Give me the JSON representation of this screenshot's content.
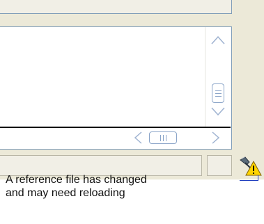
{
  "callout": {
    "line1": "A reference file has changed",
    "line2": "and may need reloading"
  },
  "icons": {
    "scroll_up": "chevron-up-icon",
    "scroll_down": "chevron-down-icon",
    "scroll_left": "chevron-left-icon",
    "scroll_right": "chevron-right-icon",
    "reload_status": "warning-reload-icon"
  },
  "colors": {
    "callout_line": "#1f3fbf",
    "warning_yellow": "#ffd500",
    "panel_border": "#7f9db9"
  }
}
